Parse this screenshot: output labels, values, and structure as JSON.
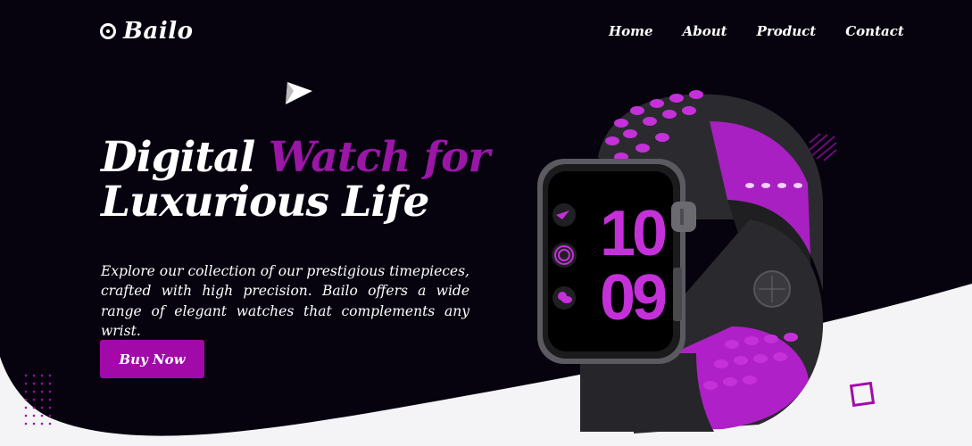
{
  "brand": {
    "name": "Bailo",
    "icon": "target-circle-icon"
  },
  "nav": {
    "items": [
      {
        "label": "Home"
      },
      {
        "label": "About"
      },
      {
        "label": "Product"
      },
      {
        "label": "Contact"
      }
    ]
  },
  "hero": {
    "title_part1": "Digital",
    "title_accent": "Watch for",
    "title_line2": "Luxurious Life",
    "description": "Explore our collection of our prestigious timepieces, crafted with high precision. Bailo offers a wide range of elegant watches that complements any wrist.",
    "cta_label": "Buy Now"
  },
  "watch": {
    "hour": "10",
    "minute": "09"
  },
  "colors": {
    "background_dark": "#06030f",
    "accent": "#a10aa9",
    "watch_accent": "#c431d9",
    "light_bg": "#f4f4f6"
  }
}
